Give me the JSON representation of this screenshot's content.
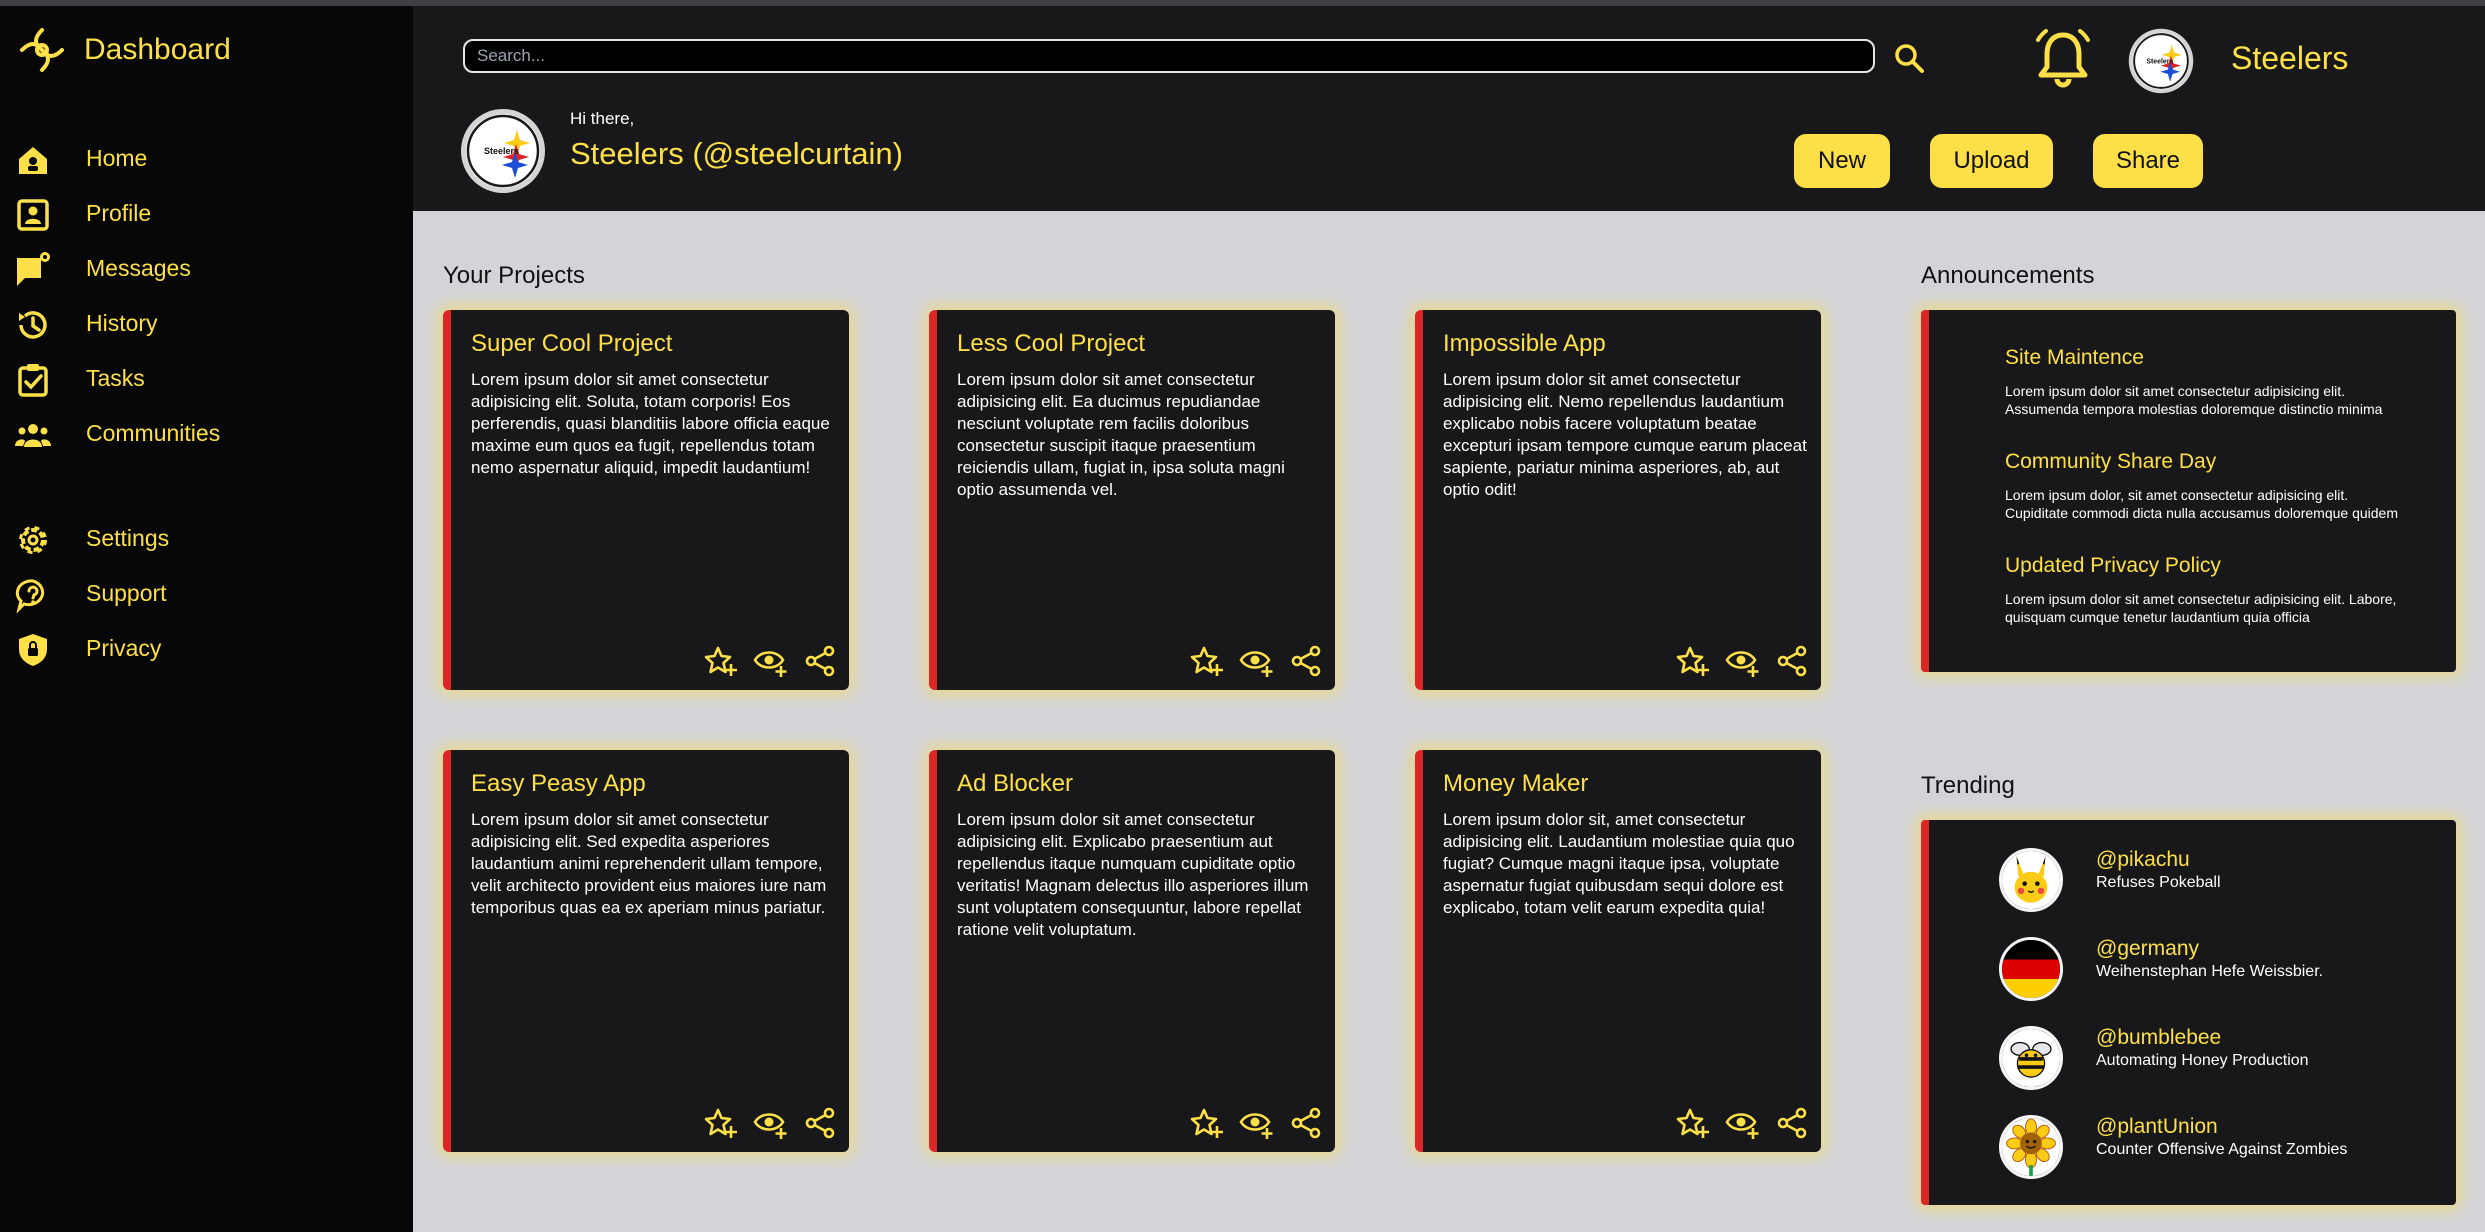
{
  "app": {
    "title": "Dashboard"
  },
  "colors": {
    "accent": "#fde047",
    "card_border": "#dc2626",
    "sidebar_bg": "#070707",
    "card_bg": "#18181b",
    "content_bg": "#d4d4d8"
  },
  "sidebar": {
    "items": [
      {
        "label": "Home",
        "icon": "home-icon"
      },
      {
        "label": "Profile",
        "icon": "profile-icon"
      },
      {
        "label": "Messages",
        "icon": "messages-icon"
      },
      {
        "label": "History",
        "icon": "history-icon"
      },
      {
        "label": "Tasks",
        "icon": "tasks-icon"
      },
      {
        "label": "Communities",
        "icon": "communities-icon"
      },
      {
        "label": "Settings",
        "icon": "gear-icon"
      },
      {
        "label": "Support",
        "icon": "support-icon"
      },
      {
        "label": "Privacy",
        "icon": "shield-icon"
      }
    ]
  },
  "header": {
    "search_placeholder": "Search...",
    "team_name": "Steelers",
    "greeting": "Hi there,",
    "username": "Steelers (@steelcurtain)",
    "buttons": {
      "new": "New",
      "upload": "Upload",
      "share": "Share"
    }
  },
  "projects": {
    "title": "Your Projects",
    "items": [
      {
        "title": "Super Cool Project",
        "body": "Lorem ipsum dolor sit amet consectetur adipisicing elit. Soluta, totam corporis! Eos perferendis, quasi blanditiis labore officia eaque maxime eum quos ea fugit, repellendus totam nemo aspernatur aliquid, impedit laudantium!"
      },
      {
        "title": "Less Cool Project",
        "body": "Lorem ipsum dolor sit amet consectetur adipisicing elit. Ea ducimus repudiandae nesciunt voluptate rem facilis doloribus consectetur suscipit itaque praesentium reiciendis ullam, fugiat in, ipsa soluta magni optio assumenda vel."
      },
      {
        "title": "Impossible App",
        "body": "Lorem ipsum dolor sit amet consectetur adipisicing elit. Nemo repellendus laudantium explicabo nobis facere voluptatum beatae excepturi ipsam tempore cumque earum placeat sapiente, pariatur minima asperiores, ab, aut optio odit!"
      },
      {
        "title": "Easy Peasy App",
        "body": "Lorem ipsum dolor sit amet consectetur adipisicing elit. Sed expedita asperiores laudantium animi reprehenderit ullam tempore, velit architecto provident eius maiores iure nam temporibus quas ea ex aperiam minus pariatur."
      },
      {
        "title": "Ad Blocker",
        "body": "Lorem ipsum dolor sit amet consectetur adipisicing elit. Explicabo praesentium aut repellendus itaque numquam cupiditate optio veritatis! Magnam delectus illo asperiores illum sunt voluptatem consequuntur, labore repellat ratione velit voluptatum."
      },
      {
        "title": "Money Maker",
        "body": "Lorem ipsum dolor sit, amet consectetur adipisicing elit. Laudantium molestiae quia quo fugiat? Cumque magni itaque ipsa, voluptate aspernatur fugiat quibusdam sequi dolore est explicabo, totam velit earum expedita quia!"
      }
    ]
  },
  "announcements": {
    "title": "Announcements",
    "items": [
      {
        "title": "Site Maintence",
        "line1": "Lorem ipsum dolor sit amet consectetur adipisicing elit.",
        "line2": "Assumenda tempora molestias doloremque distinctio minima"
      },
      {
        "title": "Community Share Day",
        "line1": "Lorem ipsum dolor, sit amet consectetur adipisicing elit.",
        "line2": "Cupiditate commodi dicta nulla accusamus doloremque quidem"
      },
      {
        "title": "Updated Privacy Policy",
        "line1": "Lorem ipsum dolor sit amet consectetur adipisicing elit. Labore,",
        "line2": "quisquam cumque tenetur laudantium quia officia"
      }
    ]
  },
  "trending": {
    "title": "Trending",
    "items": [
      {
        "handle": "@pikachu",
        "desc": "Refuses Pokeball"
      },
      {
        "handle": "@germany",
        "desc": "Weihenstephan Hefe Weissbier."
      },
      {
        "handle": "@bumblebee",
        "desc": "Automating Honey Production"
      },
      {
        "handle": "@plantUnion",
        "desc": "Counter Offensive Against Zombies"
      }
    ]
  }
}
